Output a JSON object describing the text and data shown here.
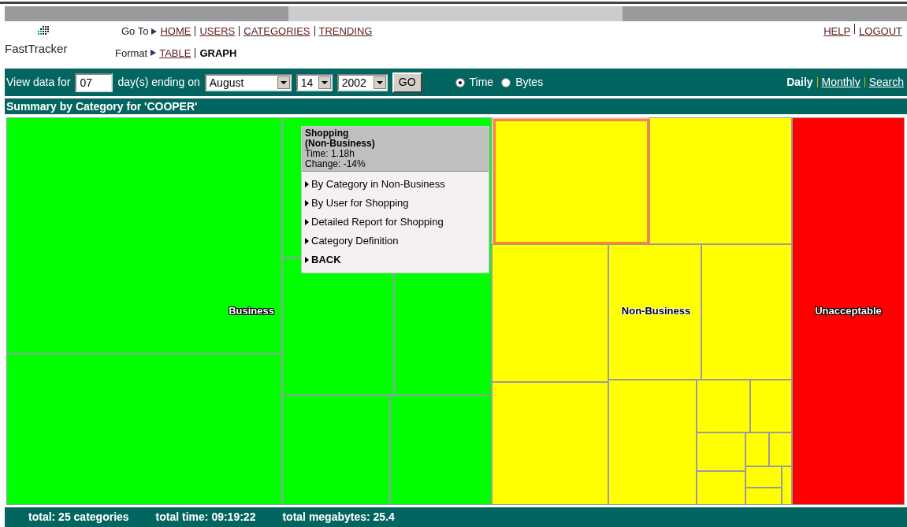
{
  "header": {
    "logo": "FastTracker",
    "goto_label": "Go To",
    "goto_links": [
      "HOME",
      "USERS",
      "CATEGORIES",
      "TRENDING"
    ],
    "format_label": "Format",
    "formats": [
      {
        "label": "TABLE",
        "selected": false
      },
      {
        "label": "GRAPH",
        "selected": true
      }
    ],
    "account_links": [
      "HELP",
      "LOGOUT"
    ]
  },
  "filter": {
    "prefix": "View data for",
    "days": "07",
    "middle": "day(s) ending on",
    "month": "August",
    "day": "14",
    "year": "2002",
    "go": "GO",
    "measures": [
      {
        "label": "Time",
        "selected": true
      },
      {
        "label": "Bytes",
        "selected": false
      }
    ],
    "periods": [
      {
        "label": "Daily",
        "selected": true
      },
      {
        "label": "Monthly",
        "selected": false
      },
      {
        "label": "Search",
        "selected": false
      }
    ]
  },
  "summary_title": "Summary by Category for 'COOPER'",
  "groups": [
    {
      "label": "Business",
      "color": "#00ff00",
      "tiles": [
        {
          "selected": false
        },
        {
          "selected": false
        },
        {
          "selected": false
        },
        {
          "selected": false
        },
        {
          "selected": false
        },
        {
          "selected": false
        },
        {
          "selected": false
        }
      ]
    },
    {
      "label": "Non-Business",
      "color": "#ffff00",
      "tiles": [
        {
          "selected": true
        },
        {
          "selected": false
        },
        {
          "selected": false
        },
        {
          "selected": false
        },
        {
          "selected": false
        },
        {
          "selected": false
        },
        {
          "selected": false
        },
        {
          "selected": false
        },
        {
          "selected": false
        },
        {
          "selected": false
        },
        {
          "selected": false
        },
        {
          "selected": false
        },
        {
          "selected": false
        },
        {
          "selected": false
        },
        {
          "selected": false
        },
        {
          "selected": false
        }
      ]
    },
    {
      "label": "Unacceptable",
      "color": "#ff0000",
      "tiles": [
        {
          "selected": false
        }
      ]
    }
  ],
  "popup": {
    "title": "Shopping",
    "subtitle": "(Non-Business)",
    "time": "Time: 1.18h",
    "change": "Change: -14%",
    "items": [
      {
        "label": "By Category in Non-Business",
        "kind": "link"
      },
      {
        "label": "By User for Shopping",
        "kind": "link"
      },
      {
        "label": "Detailed Report for Shopping",
        "kind": "link"
      },
      {
        "label": "Category Definition",
        "kind": "link"
      },
      {
        "label": "BACK",
        "kind": "back"
      }
    ]
  },
  "footer": [
    "total: 25 categories",
    "total time: 09:19:22",
    "total megabytes: 25.4"
  ]
}
